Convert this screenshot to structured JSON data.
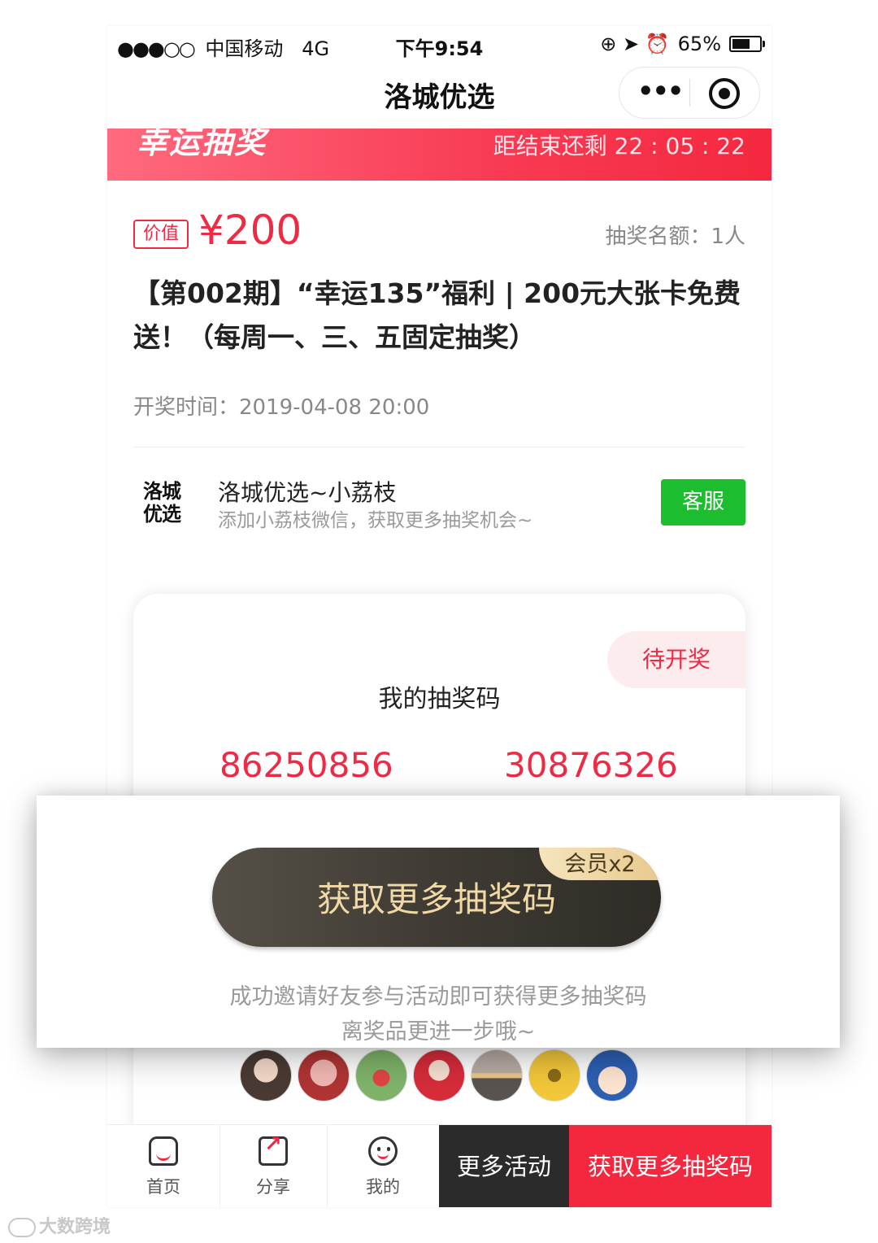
{
  "status_bar": {
    "signal": "●●●○○",
    "carrier": "中国移动",
    "network": "4G",
    "time": "下午9:54",
    "icons": "⊕ ➤ ⏰",
    "battery": "65%",
    "battery_level": 0.65
  },
  "navbar": {
    "title": "洛城优选",
    "more_icon": "•••"
  },
  "banner": {
    "logo_text": "幸运抽奖",
    "countdown": "距结束还剩 22 : 05 : 22"
  },
  "prize": {
    "value_tag": "价值",
    "price": "¥200",
    "quota": "抽奖名额：1人",
    "title": "【第002期】“幸运135”福利 | 200元大张卡免费送！（每周一、三、五固定抽奖）",
    "draw_time": "开奖时间：2019-04-08 20:00"
  },
  "service": {
    "logo_line1": "洛城",
    "logo_line2": "优选",
    "name": "洛城优选~小荔枝",
    "desc": "添加小荔枝微信，获取更多抽奖机会~",
    "button": "客服"
  },
  "code_card": {
    "status": "待开奖",
    "title": "我的抽奖码",
    "codes": [
      "86250856",
      "30876326"
    ]
  },
  "overlay": {
    "button": "获取更多抽奖码",
    "badge": "会员x2",
    "line1": "成功邀请好友参与活动即可获得更多抽奖码",
    "line2": "离奖品更进一步哦~"
  },
  "tabbar": {
    "home": "首页",
    "share": "分享",
    "mine": "我的",
    "more_activities": "更多活动",
    "get_more_codes": "获取更多抽奖码"
  },
  "watermark": "大数跨境",
  "colors": {
    "accent_red": "#ee2a45",
    "service_green": "#1cbe2f",
    "dark_button": "#2b2b2b",
    "gold_text": "#f1d9a5"
  }
}
